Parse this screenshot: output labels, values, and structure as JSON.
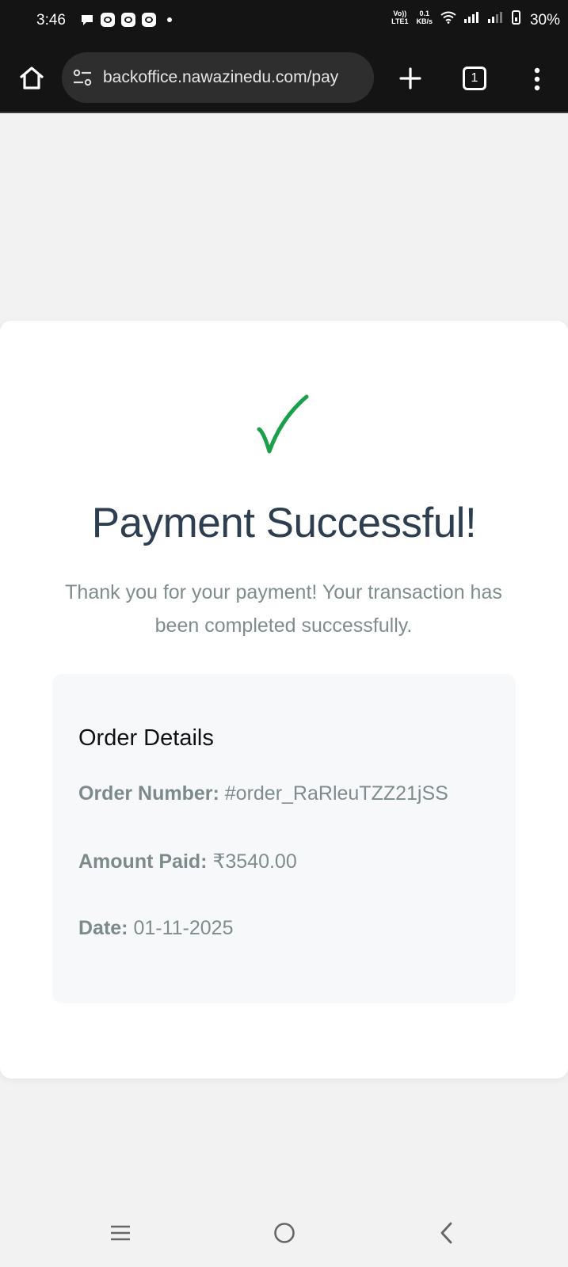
{
  "status_bar": {
    "time": "3:46",
    "volte_top": "Vo))",
    "volte_bottom": "LTE1",
    "speed_value": "0.1",
    "speed_unit": "KB/s",
    "battery_percent": "30%"
  },
  "browser": {
    "url": "backoffice.nawazinedu.com/pay",
    "tab_count": "1"
  },
  "payment": {
    "title": "Payment Successful!",
    "message": "Thank you for your payment! Your transaction has been completed successfully.",
    "check_color": "#1aa04a",
    "order_details": {
      "heading": "Order Details",
      "order_number_label": "Order Number:",
      "order_number_value": "#order_RaRleuTZZ21jSS",
      "amount_label": "Amount Paid:",
      "amount_value": "₹3540.00",
      "date_label": "Date:",
      "date_value": "01-11-2025"
    }
  },
  "icons": {
    "check": "check-icon",
    "home": "home-icon",
    "settings": "tune-icon",
    "new_tab": "plus-icon",
    "menu": "more-vert-icon",
    "recents": "recents-icon",
    "nav_home": "circle-home-icon",
    "back": "back-icon"
  },
  "colors": {
    "title": "#2c3e50",
    "text_muted": "#7f8c8d",
    "card_bg": "#ffffff",
    "page_bg": "#f2f2f2",
    "details_bg": "#f7f8fa"
  }
}
